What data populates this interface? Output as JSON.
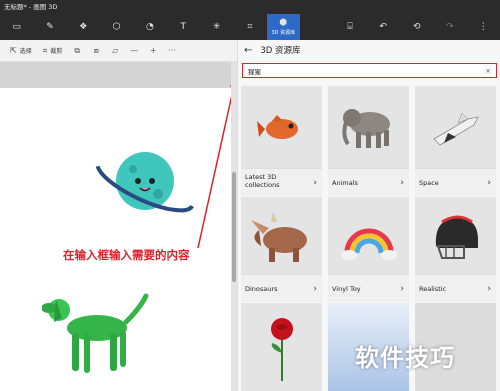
{
  "window": {
    "title": "无标题* - 画图 3D"
  },
  "toolbar": {
    "tools": [
      {
        "name": "brushes-tool",
        "glyph": "▭"
      },
      {
        "name": "2d-shapes-tool",
        "glyph": "✎"
      },
      {
        "name": "3d-shapes-tool",
        "glyph": "❖"
      },
      {
        "name": "stickers-tool",
        "glyph": "⬡"
      },
      {
        "name": "effects-tool",
        "glyph": "◔"
      },
      {
        "name": "text-tool",
        "glyph": "T"
      },
      {
        "name": "canvas-tool",
        "glyph": "✳"
      },
      {
        "name": "crop-tool",
        "glyph": "⌗"
      }
    ],
    "active_label": "3D 资源库",
    "right_icons": [
      "⌸",
      "↶",
      "⟲",
      "↷",
      "⋮"
    ]
  },
  "subbar": {
    "select_label": "选择",
    "crop_label": "裁剪",
    "right_controls": [
      "—",
      "+",
      "···"
    ]
  },
  "canvas": {
    "annotation": "在输入框输入需要的内容"
  },
  "library": {
    "title": "3D 资源库",
    "search_value": "猩猩",
    "cards": [
      {
        "label": "Latest 3D collections",
        "icon": "fish-model"
      },
      {
        "label": "Animals",
        "icon": "elephant-model"
      },
      {
        "label": "Space",
        "icon": "space-shuttle-model"
      },
      {
        "label": "Dinosaurs",
        "icon": "triceratops-model"
      },
      {
        "label": "Vinyl Toy",
        "icon": "rainbow-toy-model"
      },
      {
        "label": "Realistic",
        "icon": "helmet-model"
      },
      {
        "label": "",
        "icon": "rose-model"
      },
      {
        "label": "",
        "icon": "blue-model"
      },
      {
        "label": "",
        "icon": "grey-model"
      }
    ]
  },
  "watermark": "软件技巧",
  "colors": {
    "accent": "#2f69c7",
    "annotation_red": "#e0212b"
  }
}
